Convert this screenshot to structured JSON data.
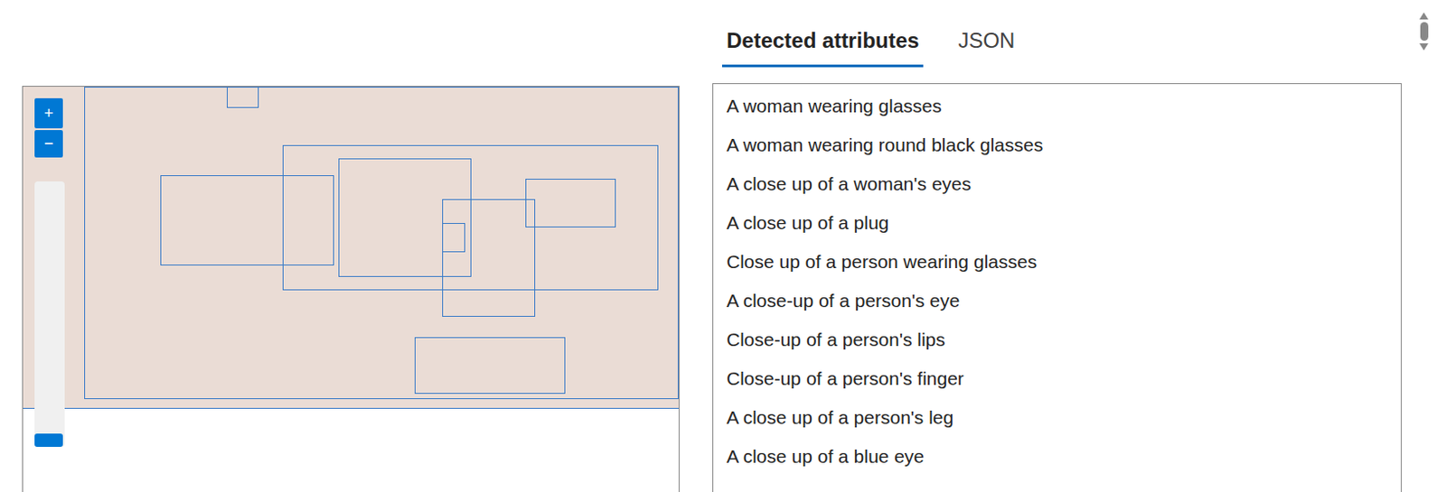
{
  "viewer": {
    "zoom_in": "+",
    "zoom_out": "−",
    "zoom": {
      "level": 0
    }
  },
  "tabs": [
    {
      "label": "Detected attributes",
      "selected": true
    },
    {
      "label": "JSON",
      "selected": false
    }
  ],
  "attributes": [
    "A woman wearing glasses",
    "A woman wearing round black glasses",
    "A close up of a woman's eyes",
    "A close up of a plug",
    "Close up of a person wearing glasses",
    "A close-up of a person's eye",
    "Close-up of a person's lips",
    "Close-up of a person's finger",
    "A close up of a person's leg",
    "A close up of a blue eye"
  ]
}
